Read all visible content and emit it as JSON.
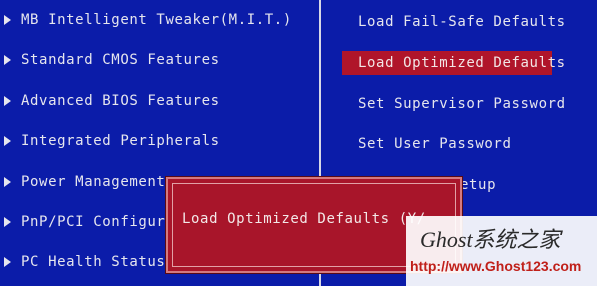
{
  "left_menu": [
    {
      "label": "MB Intelligent Tweaker(M.I.T.)"
    },
    {
      "label": "Standard CMOS Features"
    },
    {
      "label": "Advanced BIOS Features"
    },
    {
      "label": "Integrated Peripherals"
    },
    {
      "label": "Power Management"
    },
    {
      "label": "PnP/PCI Configura"
    },
    {
      "label": "PC Health Status"
    }
  ],
  "right_menu": [
    {
      "label": "Load Fail-Safe Defaults"
    },
    {
      "label": "Load Optimized Defaults"
    },
    {
      "label": "Set Supervisor Password"
    },
    {
      "label": "Set User Password"
    },
    {
      "label": "etup"
    }
  ],
  "dialog": {
    "prompt": "Load Optimized Defaults (Y/"
  },
  "watermark": {
    "brand": "Ghost系统之家",
    "url": "http://www.Ghost123.com"
  },
  "colors": {
    "background": "#0b1ca9",
    "highlight": "#b0152a",
    "dialog": "#a8152a",
    "text": "#e6e6ee"
  }
}
